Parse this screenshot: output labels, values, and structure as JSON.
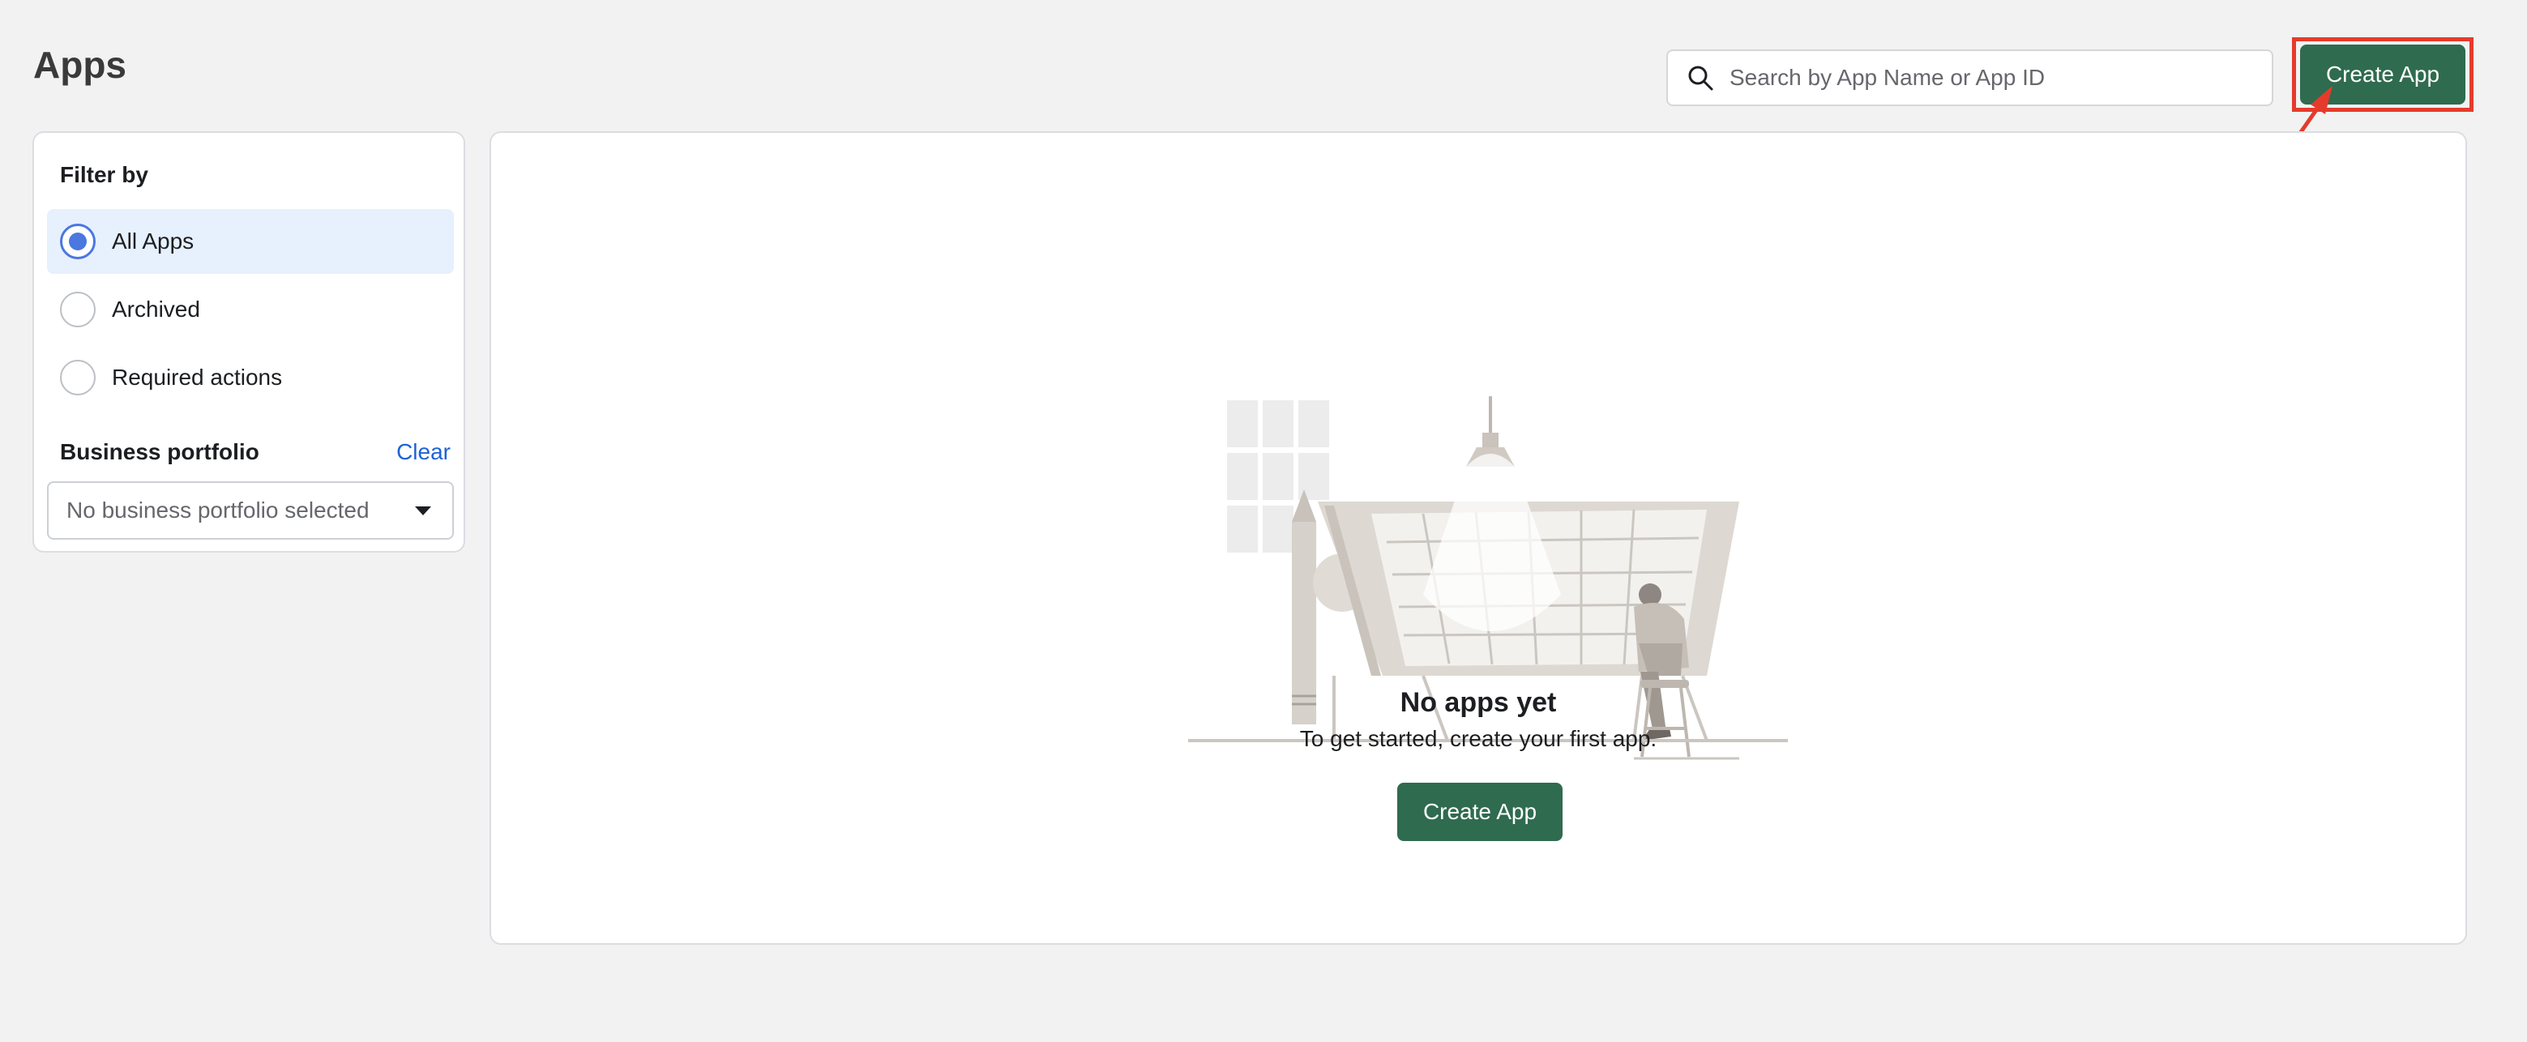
{
  "page": {
    "title": "Apps"
  },
  "search": {
    "placeholder": "Search by App Name or App ID",
    "value": ""
  },
  "header": {
    "create_label": "Create App"
  },
  "filter": {
    "title": "Filter by",
    "options": [
      {
        "label": "All Apps",
        "selected": true
      },
      {
        "label": "Archived",
        "selected": false
      },
      {
        "label": "Required actions",
        "selected": false
      }
    ],
    "portfolio_heading": "Business portfolio",
    "clear_label": "Clear",
    "portfolio_select_value": "No business portfolio selected"
  },
  "empty_state": {
    "title": "No apps yet",
    "subtitle": "To get started, create your first app.",
    "create_label": "Create App"
  },
  "colors": {
    "primary_button": "#2f6b4f",
    "annotation_red": "#e53b2c",
    "link_blue": "#1d62d6",
    "radio_blue": "#4a77e0",
    "selected_row_bg": "#e7f0fd"
  },
  "icons": {
    "search": "search-icon",
    "select_caret": "caret-down-icon"
  }
}
